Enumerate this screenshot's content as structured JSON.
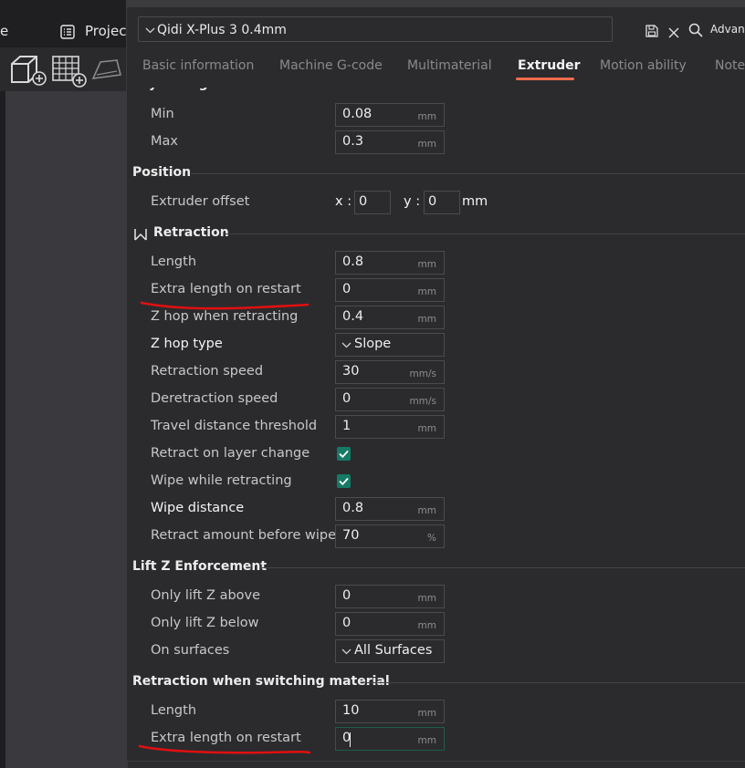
{
  "background": {
    "menu_partial": "e",
    "project_label": "Project"
  },
  "dialog": {
    "preset": "Qidi X-Plus 3 0.4mm",
    "advanced_label": "Advanc",
    "tabs": [
      "Basic information",
      "Machine G-code",
      "Multimaterial",
      "Extruder",
      "Motion ability",
      "Note"
    ],
    "active_tab": "Extruder"
  },
  "layer_height_limits": {
    "title": "Layer height limits",
    "min": {
      "label": "Min",
      "value": "0.08",
      "unit": "mm"
    },
    "max": {
      "label": "Max",
      "value": "0.3",
      "unit": "mm"
    }
  },
  "position": {
    "title": "Position",
    "offset_label": "Extruder offset",
    "x_label": "x :",
    "x_value": "0",
    "y_label": "y :",
    "y_value": "0",
    "unit": "mm"
  },
  "retraction": {
    "title": "Retraction",
    "length": {
      "label": "Length",
      "value": "0.8",
      "unit": "mm"
    },
    "extra_length": {
      "label": "Extra length on restart",
      "value": "0",
      "unit": "mm"
    },
    "z_hop": {
      "label": "Z hop when retracting",
      "value": "0.4",
      "unit": "mm"
    },
    "z_hop_type": {
      "label": "Z hop type",
      "value": "Slope"
    },
    "retraction_speed": {
      "label": "Retraction speed",
      "value": "30",
      "unit": "mm/s"
    },
    "deretraction_speed": {
      "label": "Deretraction speed",
      "value": "0",
      "unit": "mm/s"
    },
    "travel_threshold": {
      "label": "Travel distance threshold",
      "value": "1",
      "unit": "mm"
    },
    "retract_layer_change": {
      "label": "Retract on layer change",
      "checked": true
    },
    "wipe": {
      "label": "Wipe while retracting",
      "checked": true
    },
    "wipe_distance": {
      "label": "Wipe distance",
      "value": "0.8",
      "unit": "mm"
    },
    "retract_before_wipe": {
      "label": "Retract amount before wipe",
      "value": "70",
      "unit": "%"
    }
  },
  "lift_z": {
    "title": "Lift Z Enforcement",
    "above": {
      "label": "Only lift Z above",
      "value": "0",
      "unit": "mm"
    },
    "below": {
      "label": "Only lift Z below",
      "value": "0",
      "unit": "mm"
    },
    "surfaces": {
      "label": "On surfaces",
      "value": "All Surfaces"
    }
  },
  "switching": {
    "title": "Retraction when switching material",
    "length": {
      "label": "Length",
      "value": "10",
      "unit": "mm"
    },
    "extra_length": {
      "label": "Extra length on restart",
      "value": "0",
      "unit": "mm"
    }
  },
  "colors": {
    "accent": "#ee6c4d",
    "checkbox": "#157a66",
    "annotation": "#e01010"
  }
}
